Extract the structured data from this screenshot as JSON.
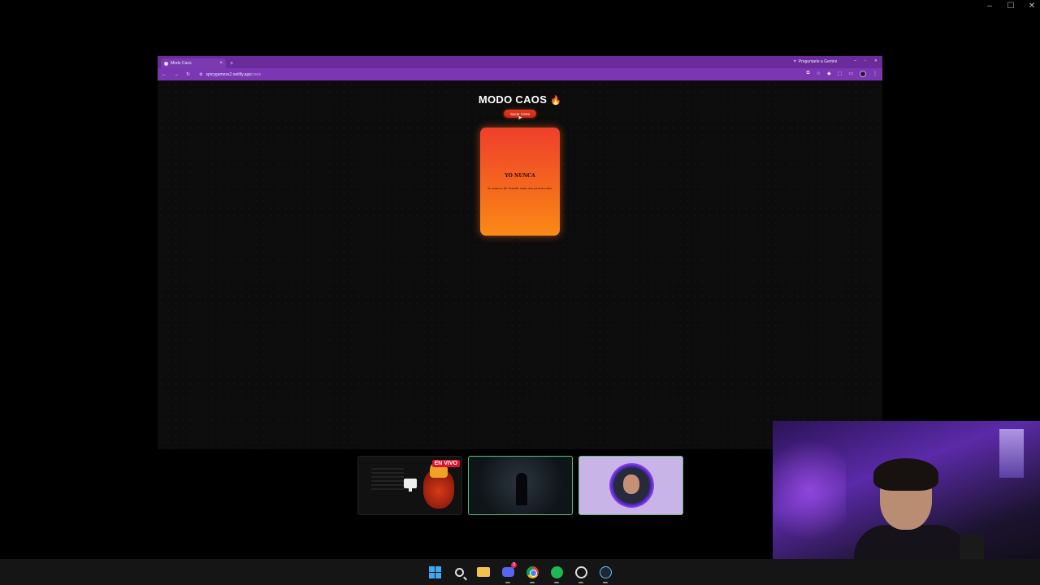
{
  "os": {
    "window_controls": [
      "–",
      "☐",
      "✕"
    ]
  },
  "browser": {
    "tab": {
      "title": "Modo Caos",
      "close": "×"
    },
    "new_tab": "+",
    "gemini_label": "Preguntarle a Gemini",
    "window_controls": [
      "–",
      "▫",
      "✕"
    ],
    "nav": {
      "back": "←",
      "forward": "→",
      "reload": "↻"
    },
    "url": {
      "host": "spicygamess2.netlify.app",
      "path": "/caos"
    }
  },
  "page": {
    "title": "MODO CAOS",
    "title_emoji": "🔥",
    "draw_button": "Sacar Carta",
    "card": {
      "title": "YO NUNCA",
      "text": "Yo nunca he tenido sexo sin protección."
    }
  },
  "stream": {
    "live_badge": "EN VIVO"
  },
  "taskbar": {
    "discord_badge": "3"
  },
  "colors": {
    "tab_bar": "#6a2c9a",
    "toolbar": "#7b36b3",
    "card_top": "#ef3f2b",
    "card_bottom": "#fb8a16",
    "live_red": "#e0122e",
    "thumb_border": "#5bc07a"
  }
}
